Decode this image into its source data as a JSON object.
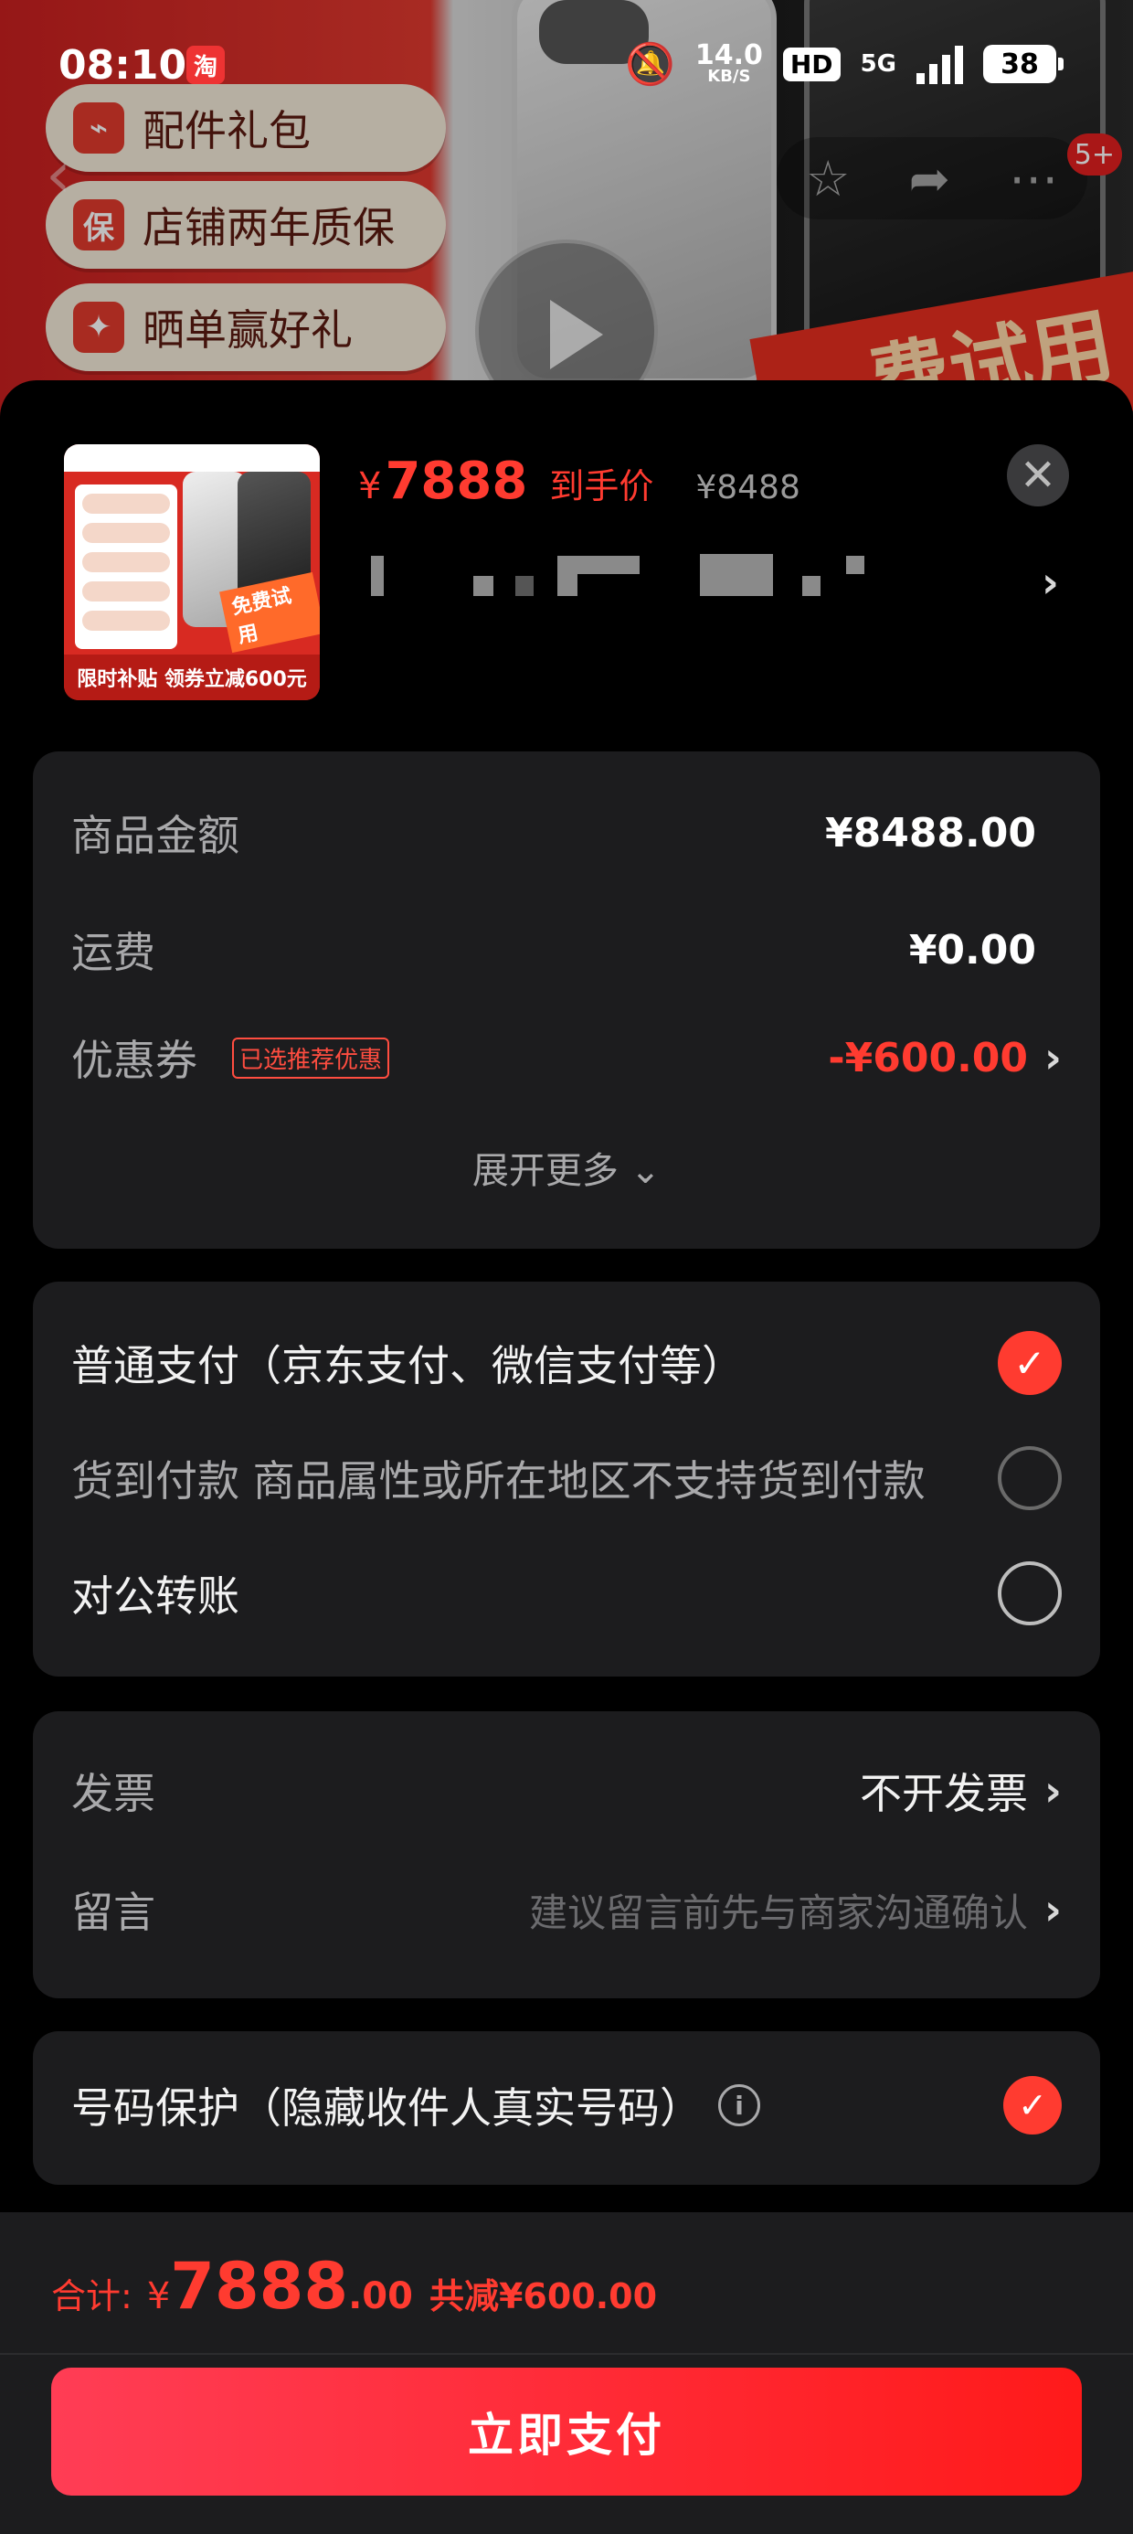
{
  "status_bar": {
    "time": "08:10",
    "app_icon": "淘",
    "speed_value": "14.0",
    "speed_unit": "KB/S",
    "hd": "HD",
    "network": "5G",
    "battery": "38"
  },
  "background": {
    "pills": [
      "配件礼包",
      "店铺两年质保",
      "晒单赢好礼"
    ],
    "pill_icons": [
      "plug-icon",
      "shield-icon",
      "gift-icon"
    ],
    "banner": "费试用",
    "badge": "5+",
    "icons": [
      "star-icon",
      "share-icon",
      "more-icon"
    ]
  },
  "product": {
    "image_tag": "免费试用",
    "image_bottom": "限时补贴 领券立减600元",
    "price_currency": "¥",
    "price": "7888",
    "price_label": "到手价",
    "original_price": "¥8488"
  },
  "summary": {
    "goods_label": "商品金额",
    "goods_value": "¥8488.00",
    "shipping_label": "运费",
    "shipping_value": "¥0.00",
    "coupon_label": "优惠券",
    "coupon_tag": "已选推荐优惠",
    "coupon_value": "-¥600.00",
    "expand_label": "展开更多"
  },
  "payment": {
    "option1": "普通支付（京东支付、微信支付等）",
    "option2": "货到付款 商品属性或所在地区不支持货到付款",
    "option3": "对公转账",
    "selected": "option1"
  },
  "extras": {
    "invoice_label": "发票",
    "invoice_value": "不开发票",
    "message_label": "留言",
    "message_placeholder": "建议留言前先与商家沟通确认"
  },
  "privacy": {
    "label": "号码保护（隐藏收件人真实号码）",
    "checked": true
  },
  "footer": {
    "total_label": "合计:",
    "currency": "¥",
    "total_int": "7888",
    "total_dec": ".00",
    "saved": "共减¥600.00",
    "pay_button": "立即支付"
  },
  "colors": {
    "accent": "#ff3b30",
    "card": "#1c1c1e",
    "sheet": "#000000"
  }
}
